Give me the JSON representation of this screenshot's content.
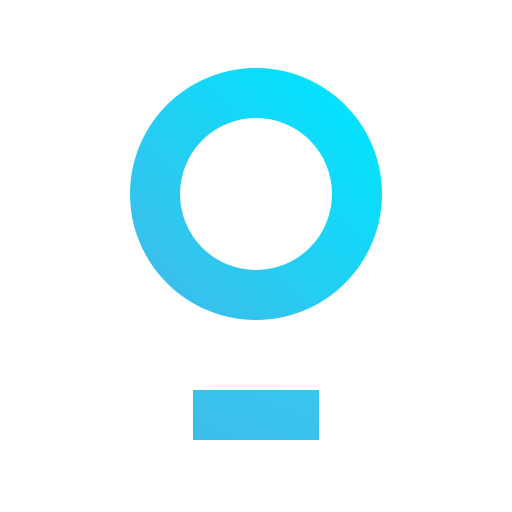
{
  "logo": {
    "gradient_start": "#3dbdea",
    "gradient_end": "#00e5ff",
    "background": "#ffffff"
  },
  "icons": {
    "ring": "ring-icon",
    "bar": "bar-icon"
  }
}
